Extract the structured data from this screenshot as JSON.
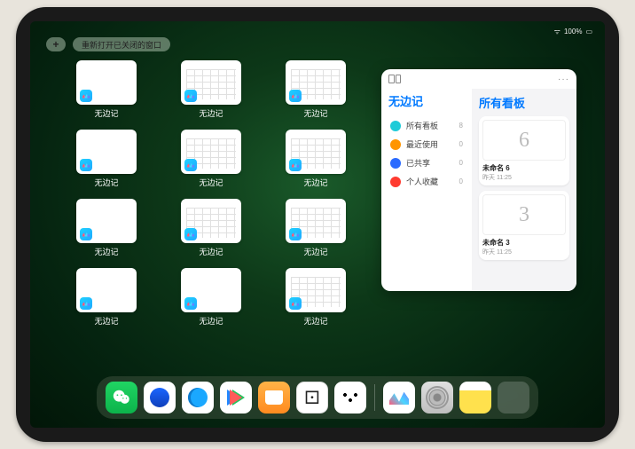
{
  "status": {
    "battery": "100%"
  },
  "controls": {
    "plus": "+",
    "reopen_label": "重新打开已关闭的窗口"
  },
  "tile_app_name": "无边记",
  "tiles": [
    {
      "variant": "blank"
    },
    {
      "variant": "cal"
    },
    {
      "variant": "cal"
    },
    {
      "variant": "blank"
    },
    {
      "variant": "cal"
    },
    {
      "variant": "cal"
    },
    {
      "variant": "blank"
    },
    {
      "variant": "cal"
    },
    {
      "variant": "cal"
    },
    {
      "variant": "blank"
    },
    {
      "variant": "blank"
    },
    {
      "variant": "cal"
    }
  ],
  "freeform": {
    "sidebar_title": "无边记",
    "boards_title": "所有看板",
    "more": "···",
    "nav": [
      {
        "icon_color": "#1fcbd8",
        "label": "所有看板",
        "count": "8"
      },
      {
        "icon_color": "#ff9500",
        "label": "最近使用",
        "count": "0"
      },
      {
        "icon_color": "#2b6bff",
        "label": "已共享",
        "count": "0"
      },
      {
        "icon_color": "#ff3b30",
        "label": "个人收藏",
        "count": "0"
      }
    ],
    "boards": [
      {
        "glyph": "6",
        "name": "未命名 6",
        "time": "昨天 11:25"
      },
      {
        "glyph": "3",
        "name": "未命名 3",
        "time": "昨天 11:25"
      }
    ]
  },
  "dock": [
    {
      "name": "wechat"
    },
    {
      "name": "quark"
    },
    {
      "name": "qqbrowser"
    },
    {
      "name": "play"
    },
    {
      "name": "books"
    },
    {
      "name": "dice"
    },
    {
      "name": "connect"
    },
    {
      "name": "sep"
    },
    {
      "name": "freeform"
    },
    {
      "name": "settings"
    },
    {
      "name": "notes"
    },
    {
      "name": "app-library"
    }
  ]
}
